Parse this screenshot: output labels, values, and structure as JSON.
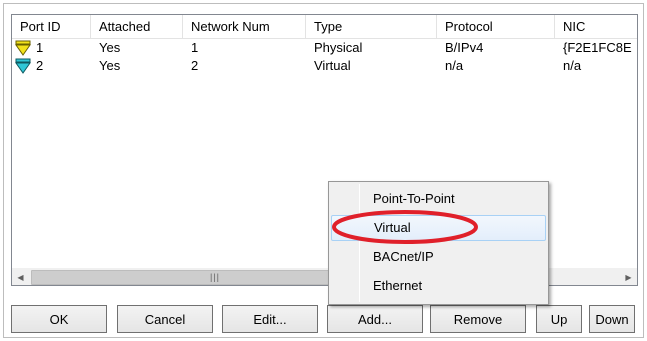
{
  "list": {
    "columns": [
      "Port ID",
      "Attached",
      "Network Num",
      "Type",
      "Protocol",
      "NIC"
    ],
    "rows": [
      {
        "port_id": "1",
        "attached": "Yes",
        "network_num": "1",
        "type": "Physical",
        "protocol": "B/IPv4",
        "nic": "{F2E1FC8E",
        "icon": "yellow-port-arrow-icon"
      },
      {
        "port_id": "2",
        "attached": "Yes",
        "network_num": "2",
        "type": "Virtual",
        "protocol": "n/a",
        "nic": "n/a",
        "icon": "cyan-port-arrow-icon"
      }
    ],
    "scrollbar": {
      "left_arrow": "◀",
      "right_arrow": "▶",
      "grip": "|||"
    }
  },
  "buttons": {
    "ok": "OK",
    "cancel": "Cancel",
    "edit": "Edit...",
    "add": "Add...",
    "remove": "Remove",
    "up": "Up",
    "down": "Down"
  },
  "menu": {
    "items": [
      "Point-To-Point",
      "Virtual",
      "BACnet/IP",
      "Ethernet"
    ],
    "highlighted_index": 1
  },
  "colors": {
    "highlight_annotation": "#e0202a",
    "port_icon_yellow": "#f2e21a",
    "port_icon_cyan": "#2fc7d6"
  }
}
